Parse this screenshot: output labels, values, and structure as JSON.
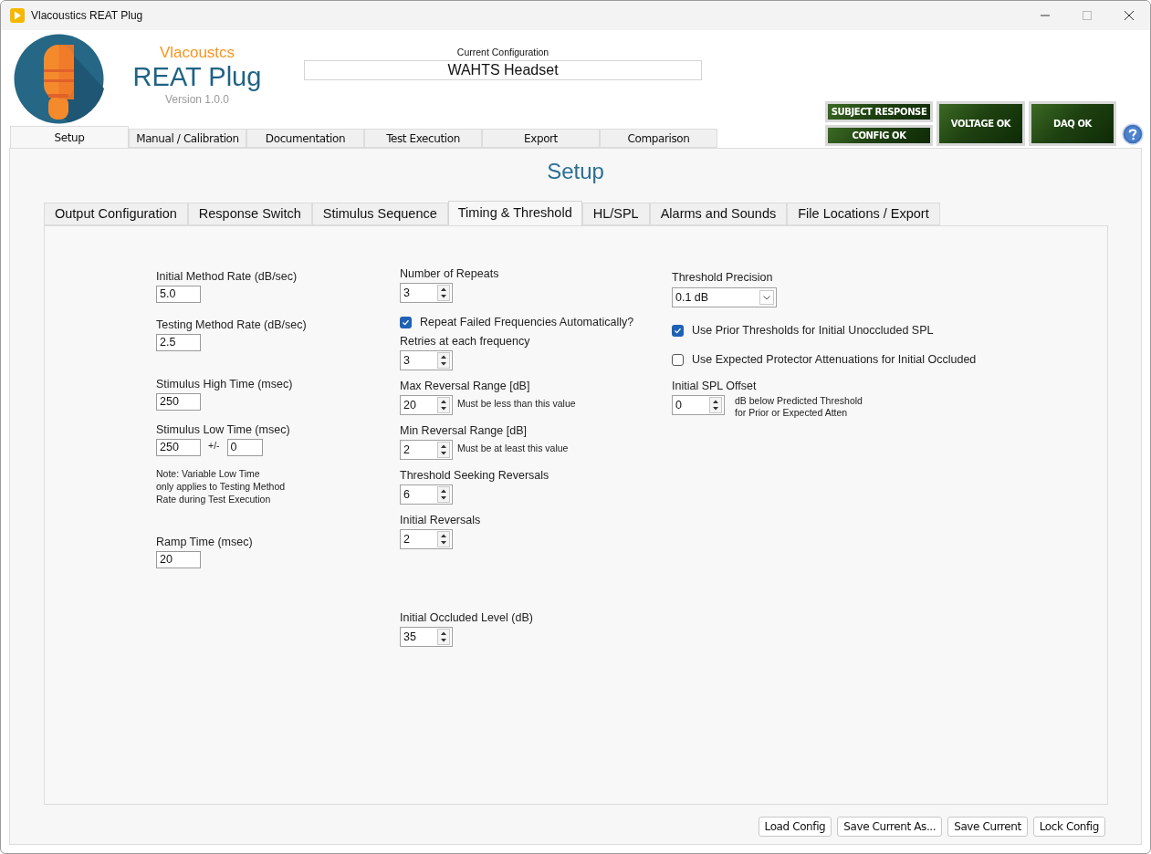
{
  "window": {
    "title": "Vlacoustics REAT Plug"
  },
  "brand": {
    "company": "Vlacoustcs",
    "product": "REAT Plug",
    "version": "Version 1.0.0"
  },
  "current_configuration": {
    "label": "Current Configuration",
    "value": "WAHTS Headset"
  },
  "indicators": [
    {
      "label": "SUBJECT RESPONSE"
    },
    {
      "label": "CONFIG OK"
    },
    {
      "label": "VOLTAGE OK"
    },
    {
      "label": "DAQ OK"
    }
  ],
  "main_tabs": [
    {
      "label": "Setup",
      "selected": true
    },
    {
      "label": "Manual / Calibration",
      "selected": false
    },
    {
      "label": "Documentation",
      "selected": false
    },
    {
      "label": "Test Execution",
      "selected": false
    },
    {
      "label": "Export",
      "selected": false
    },
    {
      "label": "Comparison",
      "selected": false
    }
  ],
  "page_title": "Setup",
  "sub_tabs": [
    {
      "label": "Output Configuration",
      "selected": false
    },
    {
      "label": "Response Switch",
      "selected": false
    },
    {
      "label": "Stimulus Sequence",
      "selected": false
    },
    {
      "label": "Timing & Threshold",
      "selected": true
    },
    {
      "label": "HL/SPL",
      "selected": false
    },
    {
      "label": "Alarms and Sounds",
      "selected": false
    },
    {
      "label": "File Locations / Export",
      "selected": false
    }
  ],
  "columns": [
    {
      "items": [
        {
          "kind": "field",
          "label": "Initial Method Rate (dB/sec)",
          "value": "5.0"
        },
        {
          "kind": "field",
          "label": "Testing Method Rate (dB/sec)",
          "value": "2.5"
        },
        {
          "kind": "field",
          "label": "Stimulus High Time (msec)",
          "value": "250"
        },
        {
          "kind": "range_field",
          "label": "Stimulus Low Time (msec)",
          "value": "250",
          "separator": "+/-",
          "tolerance": "0"
        },
        {
          "kind": "note",
          "lines": [
            "Note: Variable Low Time",
            "only applies to Testing Method",
            "Rate during Test Execution"
          ]
        },
        {
          "kind": "field",
          "label": "Ramp Time (msec)",
          "value": "20"
        }
      ]
    },
    {
      "items": [
        {
          "kind": "spinner",
          "label": "Number of Repeats",
          "value": "3"
        },
        {
          "kind": "checkbox",
          "label": "Repeat Failed Frequencies Automatically?",
          "checked": true
        },
        {
          "kind": "spinner",
          "label": "Retries at each frequency",
          "value": "3"
        },
        {
          "kind": "spinner",
          "label": "Max Reversal Range [dB]",
          "value": "20",
          "hint_lines": [
            "Must be less than this value"
          ]
        },
        {
          "kind": "spinner",
          "label": "Min Reversal Range [dB]",
          "value": "2",
          "hint_lines": [
            "Must be at least this value"
          ]
        },
        {
          "kind": "spinner",
          "label": "Threshold Seeking Reversals",
          "value": "6"
        },
        {
          "kind": "spinner",
          "label": "Initial Reversals",
          "value": "2"
        },
        {
          "kind": "spinner",
          "label": "Initial Occluded Level (dB)",
          "value": "35"
        }
      ]
    },
    {
      "items": [
        {
          "kind": "dropdown",
          "label": "Threshold Precision",
          "value": "0.1 dB"
        },
        {
          "kind": "checkbox",
          "label": "Use Prior Thresholds for Initial Unoccluded SPL",
          "checked": true
        },
        {
          "kind": "checkbox",
          "label": "Use Expected Protector Attenuations for Initial Occluded",
          "checked": false
        },
        {
          "kind": "spinner",
          "label": "Initial SPL Offset",
          "value": "0",
          "hint_lines": [
            "dB below Predicted Threshold",
            "for Prior or Expected Atten"
          ]
        }
      ]
    }
  ],
  "buttons": [
    "Load Config",
    "Save Current As...",
    "Save Current",
    "Lock Config"
  ]
}
